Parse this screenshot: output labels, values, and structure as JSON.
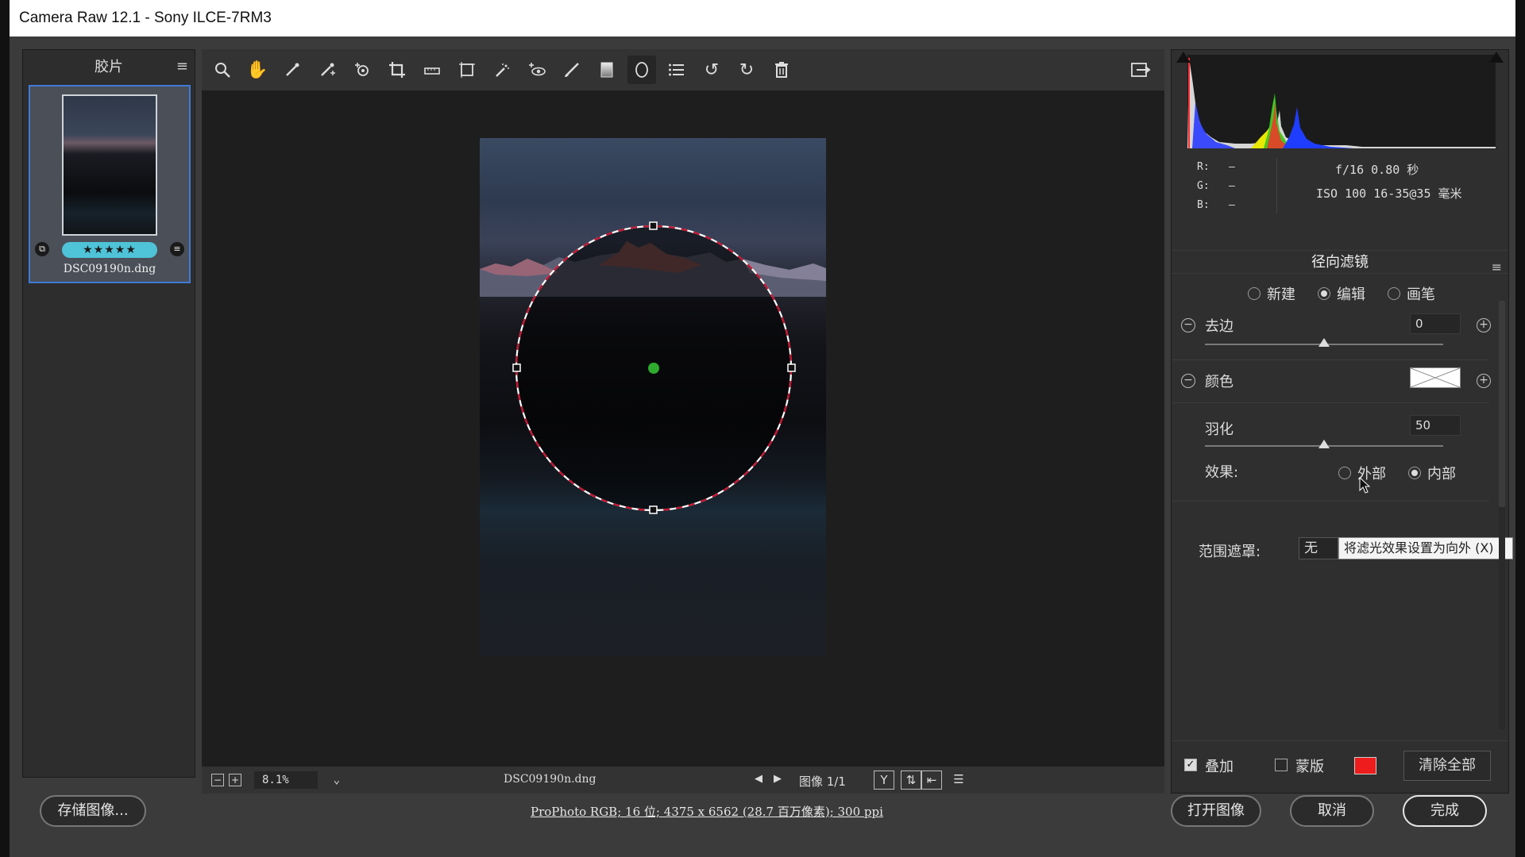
{
  "window": {
    "title": "Camera Raw 12.1 -  Sony ILCE-7RM3"
  },
  "filmstrip": {
    "title": "胶片",
    "item": {
      "filename": "DSC09190n.dng",
      "rating": "★★★★★"
    }
  },
  "toolbar": {
    "tools": [
      {
        "name": "zoom",
        "glyph": "🔍"
      },
      {
        "name": "hand",
        "glyph": "✋"
      },
      {
        "name": "white-balance",
        "glyph": "⟋"
      },
      {
        "name": "color-sampler",
        "glyph": "⟋"
      },
      {
        "name": "targeted-adjust",
        "glyph": "⊙"
      },
      {
        "name": "crop",
        "glyph": "⌐"
      },
      {
        "name": "straighten",
        "glyph": "▭"
      },
      {
        "name": "transform",
        "glyph": "⊡"
      },
      {
        "name": "spot-removal",
        "glyph": "✎"
      },
      {
        "name": "red-eye",
        "glyph": "⊕"
      },
      {
        "name": "adjustment-brush",
        "glyph": "✐"
      },
      {
        "name": "graduated-filter",
        "glyph": "▮"
      },
      {
        "name": "radial-filter",
        "glyph": "◯"
      },
      {
        "name": "preferences",
        "glyph": "☰"
      },
      {
        "name": "rotate-left",
        "glyph": "↺"
      },
      {
        "name": "rotate-right",
        "glyph": "↻"
      },
      {
        "name": "delete",
        "glyph": "🗑"
      }
    ],
    "fullscreen_glyph": "⇥"
  },
  "statusbar": {
    "zoom": "8.1%",
    "filename": "DSC09190n.dng",
    "image_count": "图像 1/1"
  },
  "info": {
    "r_label": "R:",
    "g_label": "G:",
    "b_label": "B:",
    "rgb_value": "—",
    "exposure": "f/16  0.80 秒",
    "iso_lens": "ISO 100  16-35@35 毫米"
  },
  "radial": {
    "title": "径向滤镜",
    "modes": {
      "new": "新建",
      "edit": "编辑",
      "brush": "画笔"
    },
    "defringe_label": "去边",
    "defringe_value": "0",
    "defringe_level": 0.0,
    "color_label": "颜色",
    "feather_label": "羽化",
    "feather_value": "50",
    "feather_level": 0.5,
    "effect_label": "效果:",
    "effect_outside": "外部",
    "effect_inside": "内部",
    "range_mask_label": "范围遮罩:",
    "range_mask_value": "无",
    "tooltip": "将滤光效果设置为向外 (X)",
    "overlay_label": "叠加",
    "overlay_checked": true,
    "mask_label": "蒙版",
    "mask_checked": false,
    "mask_color": "#ee1c1c",
    "clear_all": "清除全部"
  },
  "footer": {
    "save": "存储图像...",
    "workflow": "ProPhoto RGB; 16 位; 4375 x 6562 (28.7 百万像素); 300 ppi",
    "open": "打开图像",
    "cancel": "取消",
    "done": "完成"
  }
}
